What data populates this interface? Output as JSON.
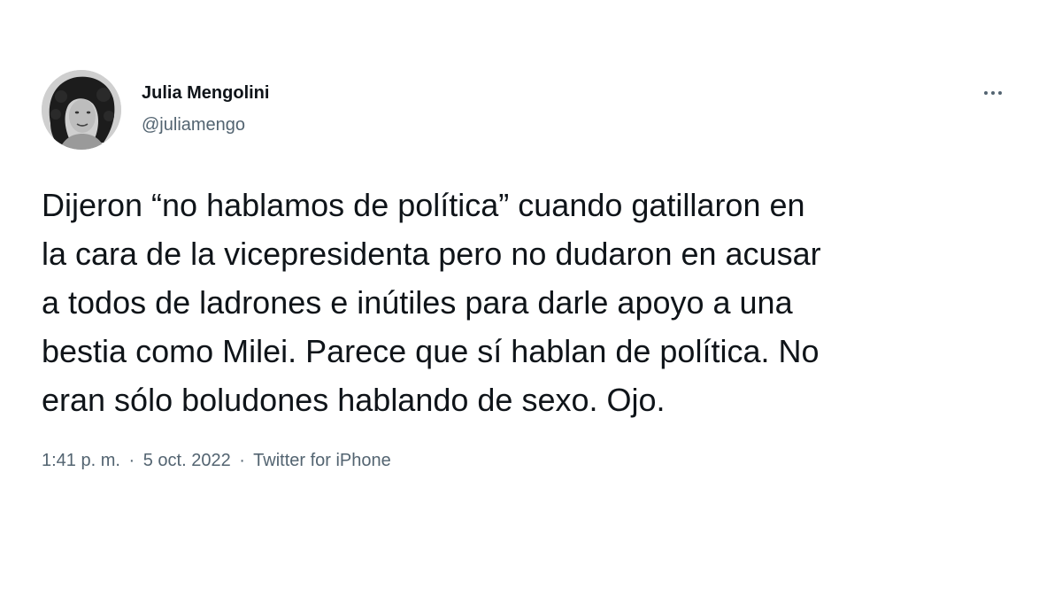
{
  "tweet": {
    "author": {
      "name": "Julia Mengolini",
      "handle": "@juliamengo"
    },
    "text": "Dijeron “no hablamos de política” cuando gatillaron en\nla cara de la vicepresidenta pero no dudaron en acusar\na todos de ladrones e inútiles para darle apoyo a una\nbestia como Milei. Parece que sí hablan de política. No\neran sólo boludones hablando de sexo. Ojo.",
    "time": "1:41 p. m.",
    "date": "5 oct. 2022",
    "separator": "·",
    "source": "Twitter for iPhone"
  },
  "icons": {
    "more": "more-options-icon",
    "avatar": "profile-photo"
  },
  "colors": {
    "text": "#0f1419",
    "secondary": "#536471",
    "background": "#ffffff"
  }
}
